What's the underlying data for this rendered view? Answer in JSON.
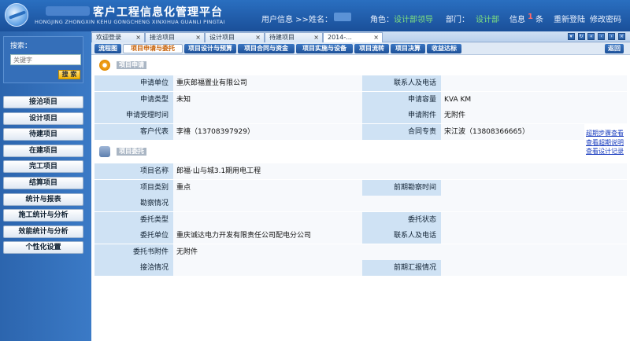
{
  "header": {
    "title": "客户工程信息化管理平台",
    "subtitle": "HONGJING ZHONGXIN KEHU GONGCHENG XINXIHUA GUANLI PINGTAI",
    "user_info": "用户信息 >>",
    "name_label": "姓名：",
    "role_label": "角色：",
    "role_value": "设计部领导",
    "dept_label": "部门：",
    "dept_value": "设计部",
    "msg_label": "信息",
    "msg_count": "1",
    "msg_unit": "条",
    "relogin": "重新登陆",
    "change_pw": "修改密码"
  },
  "sidebar": {
    "search_label": "搜索：",
    "search_placeholder": "关键字",
    "search_button": "搜 索",
    "items": [
      "接洽项目",
      "设计项目",
      "待建项目",
      "在建项目",
      "完工项目",
      "结算项目",
      "统计与报表",
      "施工统计与分析",
      "效能统计与分析",
      "个性化设置"
    ]
  },
  "tabs": [
    "欢迎登录",
    "接洽项目",
    "设计项目",
    "待建项目",
    "2014-..."
  ],
  "subtabs": [
    "流程图",
    "项目申请与委托",
    "项目设计与预算",
    "项目合同与资金",
    "项目实施与设备",
    "项目流转",
    "项目决算",
    "收益达标"
  ],
  "back_label": "返回",
  "section1": {
    "title": "项目申请"
  },
  "section2": {
    "title": "项目委托"
  },
  "apply": {
    "r1": [
      "申请单位",
      "重庆郎福置业有限公司",
      "联系人及电话",
      ""
    ],
    "r2": [
      "申请类型",
      "未知",
      "申请容量",
      "KVA   KM"
    ],
    "r3": [
      "申请受理时间",
      "",
      "申请附件",
      "无附件"
    ],
    "r4": [
      "客户代表",
      "李禧（13708397929）",
      "合同专责",
      "宋江波（13808366665）"
    ]
  },
  "links": [
    "超期步骤查看",
    "查看超期说明",
    "查看设计记录"
  ],
  "entrust": {
    "r1": [
      "项目名称",
      "郎福·山与城3.1期用电工程"
    ],
    "r2": [
      "项目类别",
      "重点",
      "前期勘察时间",
      ""
    ],
    "r3": [
      "勘察情况",
      ""
    ],
    "r4": [
      "委托类型",
      "",
      "委托状态",
      ""
    ],
    "r5": [
      "委托单位",
      "重庆诚达电力开发有限责任公司配电分公司",
      "联系人及电话",
      ""
    ],
    "r6": [
      "委托书附件",
      "无附件"
    ],
    "r7": [
      "接洽情况",
      "",
      "前期汇报情况",
      ""
    ]
  }
}
